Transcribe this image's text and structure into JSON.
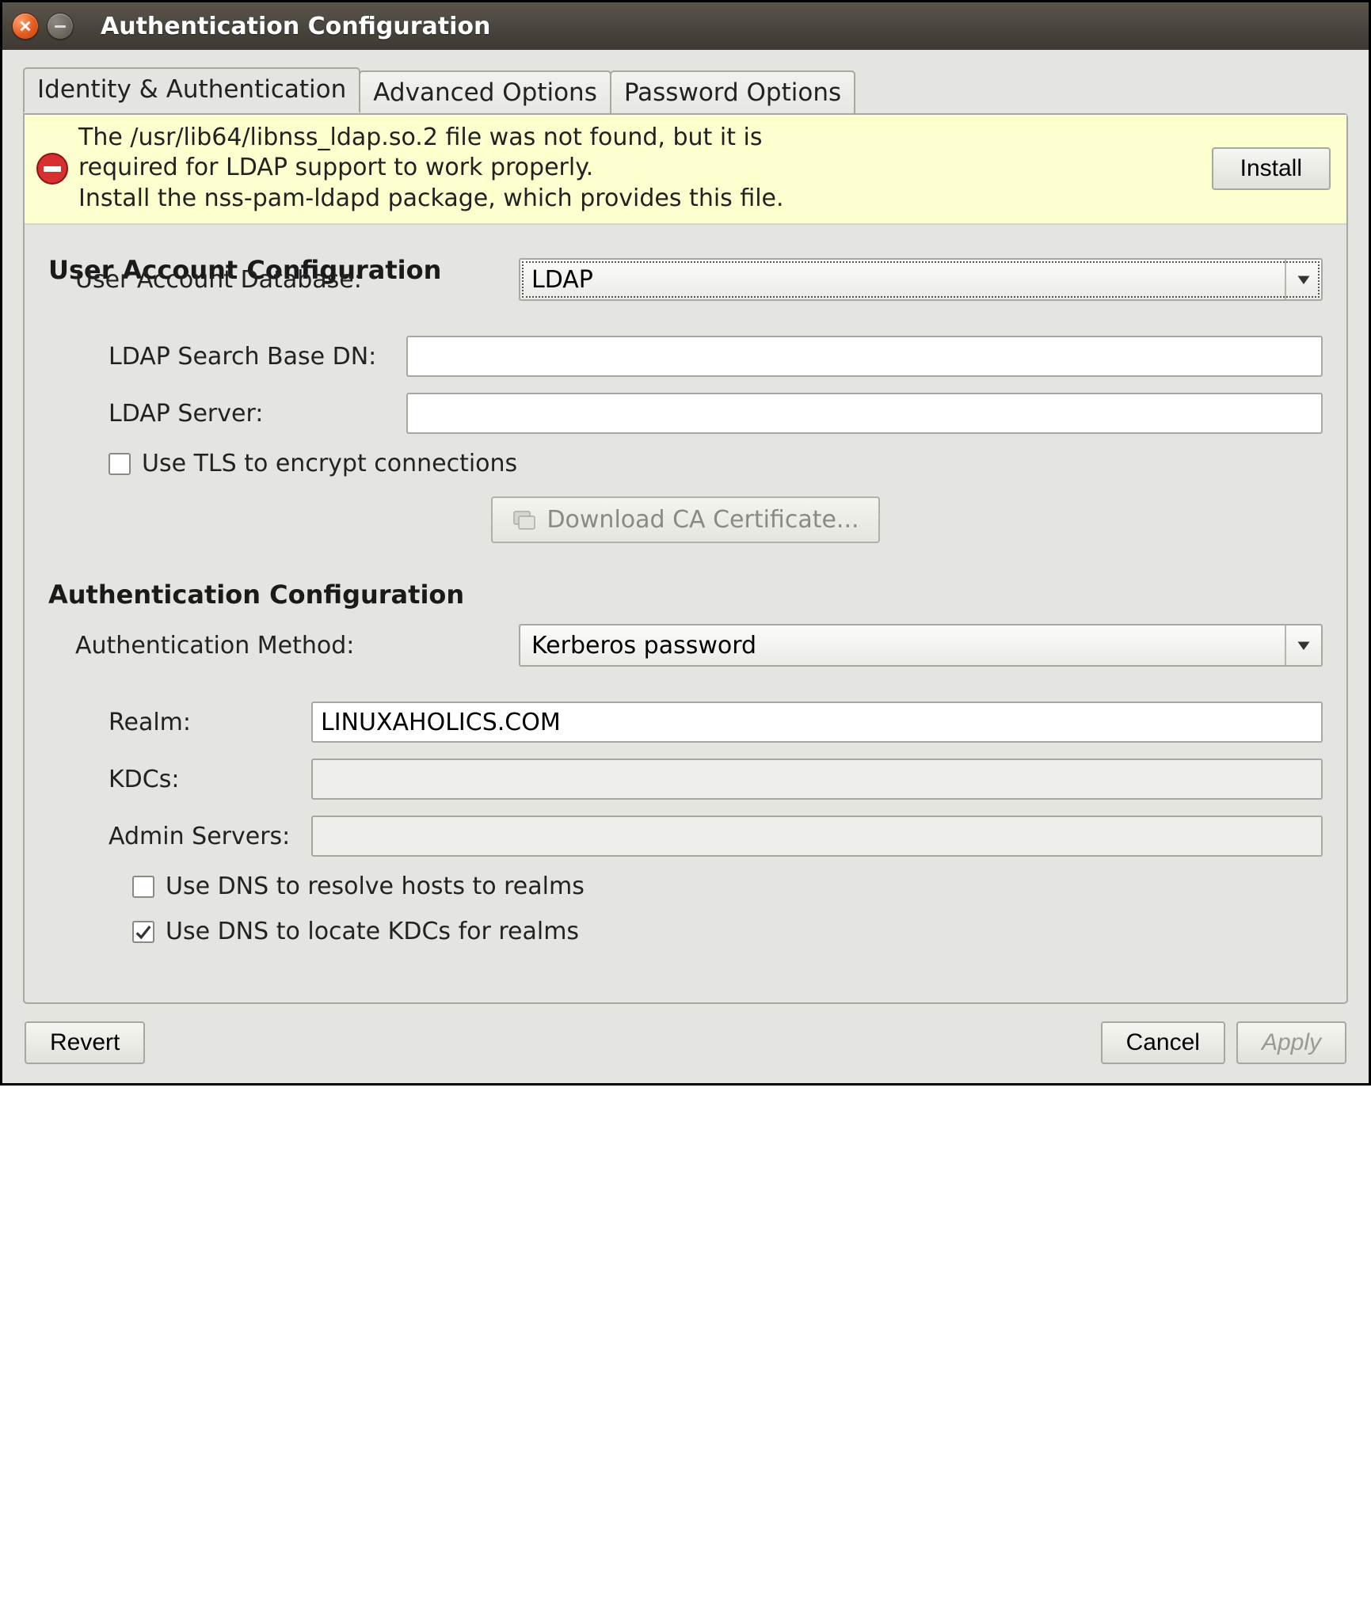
{
  "window": {
    "title": "Authentication Configuration"
  },
  "tabs": {
    "identity": "Identity & Authentication",
    "advanced": "Advanced Options",
    "password": "Password Options"
  },
  "banner": {
    "line1": "The /usr/lib64/libnss_ldap.so.2 file was not found, but it is",
    "line2": "required for LDAP support to work properly.",
    "line3": "Install the nss-pam-ldapd package, which provides this file.",
    "install_label": "Install"
  },
  "user_account": {
    "section_title": "User Account Configuration",
    "database_label": "User Account Database:",
    "database_value": "LDAP",
    "ldap_base_label": "LDAP Search Base DN:",
    "ldap_base_value": "",
    "ldap_server_label": "LDAP Server:",
    "ldap_server_value": "",
    "use_tls_label": "Use TLS to encrypt connections",
    "use_tls_checked": false,
    "download_ca_label": "Download CA Certificate..."
  },
  "auth": {
    "section_title": "Authentication Configuration",
    "method_label": "Authentication Method:",
    "method_value": "Kerberos password",
    "realm_label": "Realm:",
    "realm_value": "LINUXAHOLICS.COM",
    "kdcs_label": "KDCs:",
    "kdcs_value": "",
    "admin_label": "Admin Servers:",
    "admin_value": "",
    "dns_resolve_label": "Use DNS to resolve hosts to realms",
    "dns_resolve_checked": false,
    "dns_locate_label": "Use DNS to locate KDCs for realms",
    "dns_locate_checked": true
  },
  "footer": {
    "revert": "Revert",
    "cancel": "Cancel",
    "apply": "Apply"
  }
}
